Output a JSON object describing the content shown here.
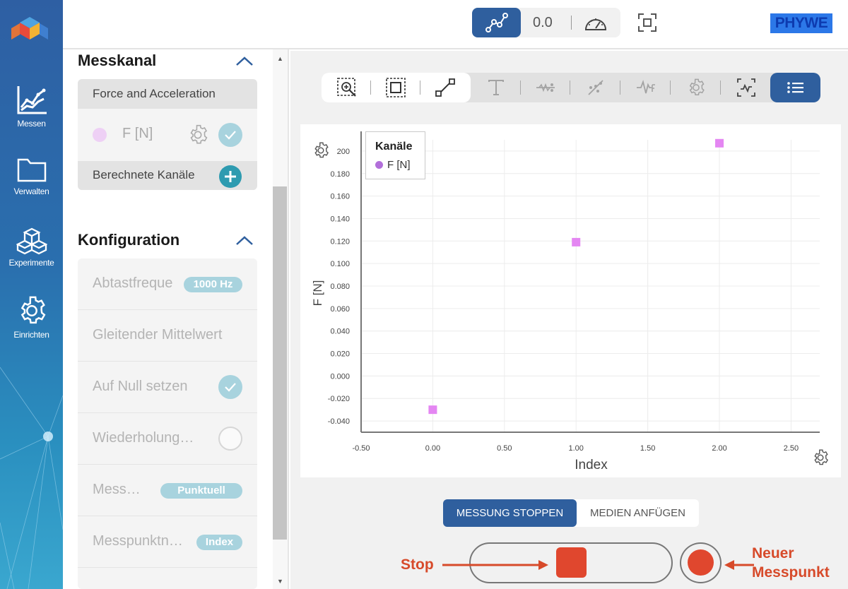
{
  "nav": {
    "items": [
      {
        "label": "Messen",
        "icon": "chart-line-icon"
      },
      {
        "label": "Verwalten",
        "icon": "folder-icon"
      },
      {
        "label": "Experimente",
        "icon": "cubes-icon"
      },
      {
        "label": "Einrichten",
        "icon": "gear-icon"
      }
    ]
  },
  "topbar": {
    "value": "0.0",
    "brand": "PHYWE"
  },
  "panel": {
    "messkanal_title": "Messkanal",
    "sensor": "Force and Acceleration",
    "channel": "F [N]",
    "computed": "Berechnete Kanäle",
    "config_title": "Konfiguration",
    "config": [
      {
        "label": "Abtastfreque",
        "badge": "1000 Hz"
      },
      {
        "label": "Gleitender Mittelwert"
      },
      {
        "label": "Auf Null setzen"
      },
      {
        "label": "Wiederholung…"
      },
      {
        "label": "Mess…",
        "badge": "Punktuell"
      },
      {
        "label": "Messpunktn…",
        "badge": "Index"
      }
    ]
  },
  "legend": {
    "title": "Kanäle",
    "item": "F [N]"
  },
  "controls": {
    "stop_measurement": "MESSUNG STOPPEN",
    "add_media": "MEDIEN ANFÜGEN"
  },
  "annotations": {
    "stop": "Stop",
    "new_point_line1": "Neuer",
    "new_point_line2": "Messpunkt"
  },
  "chart_data": {
    "type": "scatter",
    "xlabel": "Index",
    "ylabel": "F [N]",
    "xlim": [
      -0.5,
      2.7
    ],
    "ylim": [
      -0.05,
      0.21
    ],
    "x_ticks": [
      "-0.50",
      "0.00",
      "0.50",
      "1.00",
      "1.50",
      "2.00",
      "2.50"
    ],
    "y_ticks": [
      "-0.040",
      "-0.020",
      "0.000",
      "0.020",
      "0.040",
      "0.060",
      "0.080",
      "0.100",
      "0.120",
      "0.140",
      "0.160",
      "0.180",
      "200"
    ],
    "grid": true,
    "legend_position": "top-left",
    "series": [
      {
        "name": "F [N]",
        "color": "#e486f2",
        "x": [
          0,
          1,
          2
        ],
        "y": [
          -0.03,
          0.119,
          0.207
        ]
      }
    ]
  }
}
